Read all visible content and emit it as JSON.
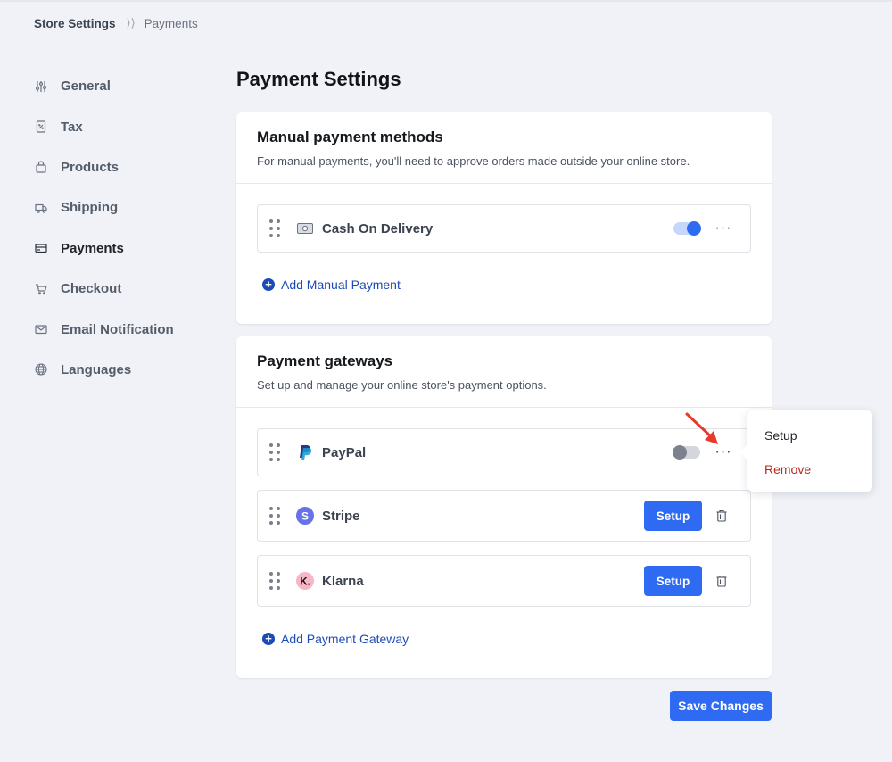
{
  "breadcrumb": {
    "root": "Store Settings",
    "current": "Payments"
  },
  "sidebar": {
    "items": [
      {
        "label": "General",
        "icon": "sliders-icon"
      },
      {
        "label": "Tax",
        "icon": "receipt-icon"
      },
      {
        "label": "Products",
        "icon": "bag-icon"
      },
      {
        "label": "Shipping",
        "icon": "truck-icon"
      },
      {
        "label": "Payments",
        "icon": "card-icon",
        "active": true
      },
      {
        "label": "Checkout",
        "icon": "cart-icon"
      },
      {
        "label": "Email Notification",
        "icon": "mail-icon"
      },
      {
        "label": "Languages",
        "icon": "globe-icon"
      }
    ]
  },
  "page": {
    "title": "Payment Settings"
  },
  "manual": {
    "title": "Manual payment methods",
    "description": "For manual payments, you'll need to approve orders made outside your online store.",
    "methods": [
      {
        "name": "Cash On Delivery",
        "enabled": true
      }
    ],
    "add_label": "Add Manual Payment"
  },
  "gateways": {
    "title": "Payment gateways",
    "description": "Set up and manage your online store's payment options.",
    "items": [
      {
        "name": "PayPal",
        "enabled": false,
        "icon": "paypal-icon"
      },
      {
        "name": "Stripe",
        "setup_label": "Setup",
        "icon": "stripe-icon",
        "icon_letter": "S"
      },
      {
        "name": "Klarna",
        "setup_label": "Setup",
        "icon": "klarna-icon",
        "icon_letter": "K."
      }
    ],
    "add_label": "Add Payment Gateway"
  },
  "context_menu": {
    "setup": "Setup",
    "remove": "Remove"
  },
  "save_label": "Save Changes",
  "colors": {
    "accent": "#2e6bf2",
    "link": "#1d4bb5",
    "danger": "#c0271d",
    "annotation_arrow": "#e8392b"
  }
}
